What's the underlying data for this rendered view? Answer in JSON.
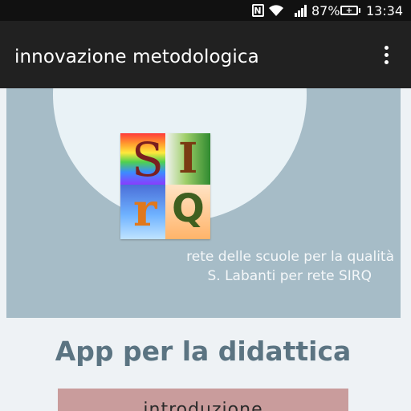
{
  "status_bar": {
    "nfc_label": "N",
    "battery_percent": "87%",
    "battery_glyph": "+",
    "time": "13:34"
  },
  "app_bar": {
    "title": "innovazione metodologica"
  },
  "hero": {
    "logo": {
      "letters": [
        "S",
        "I",
        "r",
        "Q"
      ]
    },
    "caption_line1": "rete delle scuole per la qualità",
    "caption_line2": "S. Labanti per rete SIRQ"
  },
  "section": {
    "title": "App per la didattica"
  },
  "intro_button": {
    "label": "introduzione"
  },
  "colors": {
    "status_bar_bg": "#111111",
    "app_bar_bg": "#212121",
    "hero_bg": "#a6bcc7",
    "hero_circle": "#e9f2f6",
    "section_title": "#5b7482",
    "intro_button_bg": "#c99c9c"
  }
}
